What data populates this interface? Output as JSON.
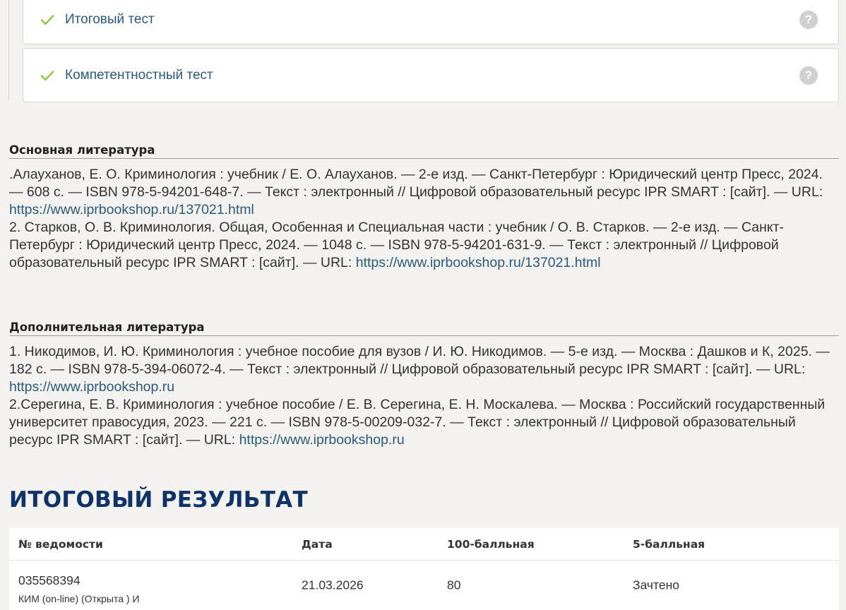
{
  "tests": [
    {
      "label": "Итоговый тест",
      "status_icon": "check-icon",
      "help_glyph": "?"
    },
    {
      "label": "Компетентностный тест",
      "status_icon": "check-icon",
      "help_glyph": "?"
    }
  ],
  "main_literature": {
    "title": "Основная литература",
    "entries": [
      {
        "text": ".Алауханов, Е. О. Криминология : учебник / Е. О. Алауханов. — 2-е изд. — Санкт-Петербург : Юридический центр Пресс, 2024. — 608 с. — ISBN 978-5-94201-648-7. — Текст : электронный // Цифровой образовательный ресурс IPR SMART : [сайт]. — URL: ",
        "url": "https://www.iprbookshop.ru/137021.html"
      },
      {
        "text": "2. Старков, О. В. Криминология. Общая, Особенная и Специальная части : учебник / О. В. Старков. — 2-е изд. — Санкт-Петербург : Юридический центр Пресс, 2024. — 1048 с. — ISBN 978-5-94201-631-9. — Текст : электронный // Цифровой образовательный ресурс IPR SMART : [сайт]. — URL: ",
        "url": "https://www.iprbookshop.ru/137021.html"
      }
    ]
  },
  "additional_literature": {
    "title": "Дополнительная литература",
    "entries": [
      {
        "text": "1. Никодимов, И. Ю. Криминология : учебное пособие для вузов / И. Ю. Никодимов. — 5-е изд. — Москва : Дашков и К, 2025. — 182 с. — ISBN 978-5-394-06072-4. — Текст : электронный // Цифровой образовательный ресурс IPR SMART : [сайт]. — URL: ",
        "url": "https://www.iprbookshop.ru"
      },
      {
        "text": "2.Серегина, Е. В. Криминология : учебное пособие / Е. В. Серегина, Е. Н. Москалева. — Москва : Российский государственный университет правосудия, 2023. — 221 с. — ISBN 978-5-00209-032-7. — Текст : электронный // Цифровой образовательный ресурс IPR SMART : [сайт]. — URL: ",
        "url": "https://www.iprbookshop.ru"
      }
    ]
  },
  "final_result": {
    "title": "ИТОГОВЫЙ РЕЗУЛЬТАТ",
    "columns": [
      "№ ведомости",
      "Дата",
      "100-балльная",
      "5-балльная"
    ],
    "rows": [
      {
        "number": "035568394",
        "sheet_type": "КИМ (on-line) (Открыта ) И",
        "date": "21.03.2026",
        "score100": "80",
        "score5": "Зачтено"
      }
    ]
  },
  "colors": {
    "check": "#8cc43c",
    "link": "#2a5b7e",
    "heading": "#0d3369",
    "help": "#cfcfcf"
  }
}
